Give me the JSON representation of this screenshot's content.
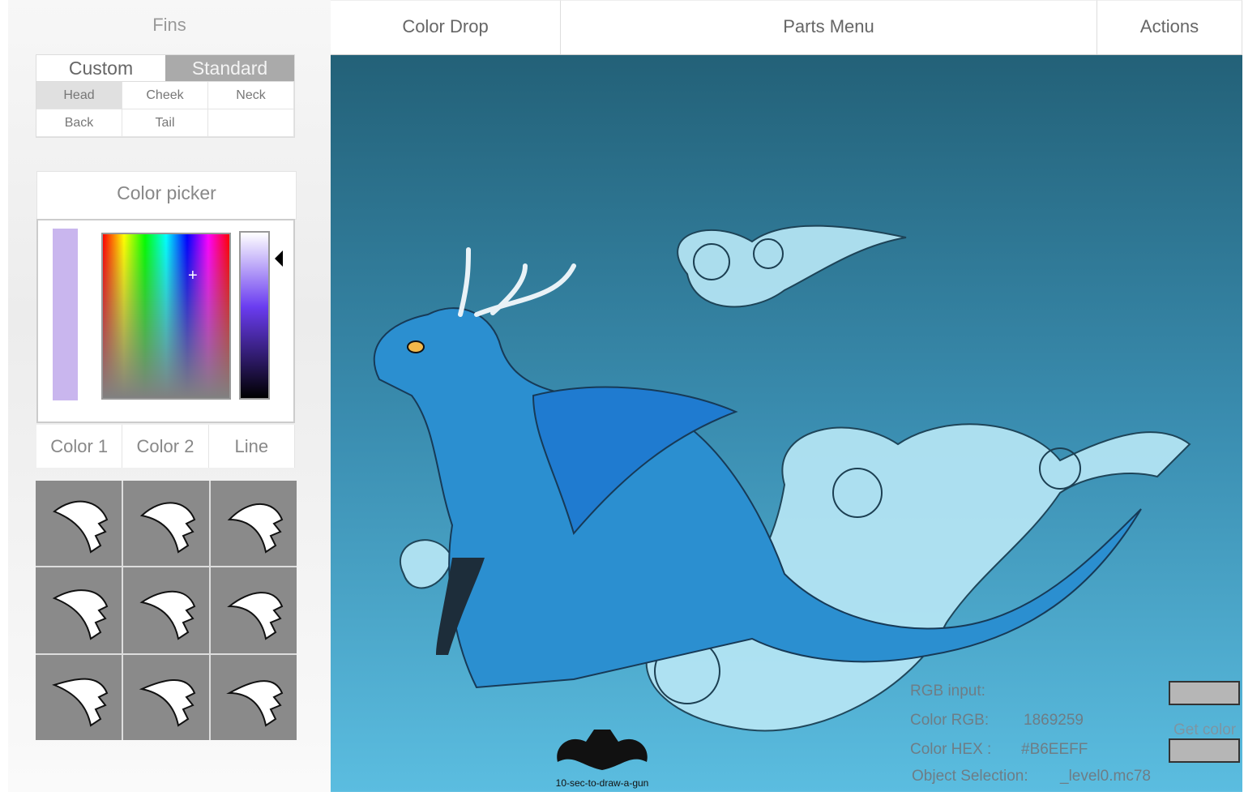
{
  "sidebar": {
    "title": "Fins",
    "mode_tabs": [
      {
        "label": "Custom",
        "active": false
      },
      {
        "label": "Standard",
        "active": true
      }
    ],
    "parts": [
      {
        "label": "Head",
        "active": true
      },
      {
        "label": "Cheek"
      },
      {
        "label": "Neck"
      },
      {
        "label": "Back"
      },
      {
        "label": "Tail"
      },
      {
        "label": ""
      }
    ],
    "color_picker": {
      "title": "Color picker",
      "swatch_color": "#c9b6ee"
    },
    "color_tabs": [
      "Color 1",
      "Color 2",
      "Line"
    ],
    "fin_options": 9
  },
  "nav": {
    "tabs": [
      "Color Drop",
      "Parts Menu",
      "Actions"
    ]
  },
  "info": {
    "rgb_input_label": "RGB input:",
    "color_rgb_label": "Color RGB:",
    "color_rgb_value": "1869259",
    "color_hex_label": "Color HEX :",
    "color_hex_value": "#B6EEFF",
    "object_selection_label": "Object Selection:",
    "object_selection_value": "_level0.mc78",
    "get_color_label": "Get color"
  },
  "watermark": "10-sec-to-draw-a-gun"
}
